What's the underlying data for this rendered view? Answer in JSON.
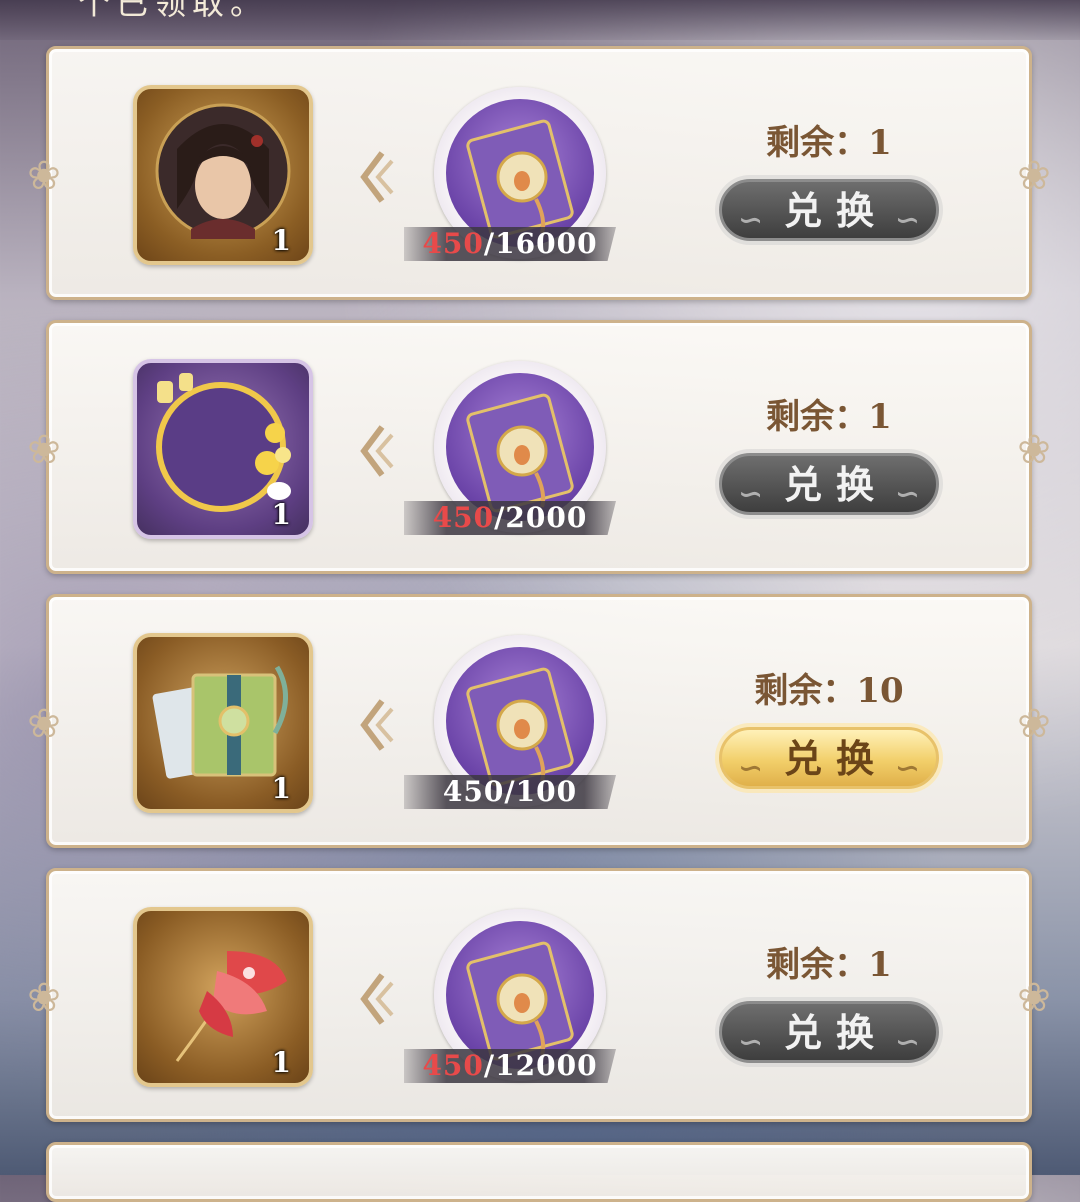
{
  "header": {
    "text_fragment": "个已领取。"
  },
  "items": [
    {
      "reward_type": "avatar",
      "reward_count": "1",
      "cost_have": "450",
      "cost_sep_total": "/16000",
      "cost_sufficient": false,
      "remaining_label": "剩余：1",
      "button_label": "兑换",
      "button_state": "disabled"
    },
    {
      "reward_type": "avatar-frame",
      "reward_count": "1",
      "cost_have": "450",
      "cost_sep_total": "/2000",
      "cost_sufficient": false,
      "remaining_label": "剩余：1",
      "button_label": "兑换",
      "button_state": "disabled"
    },
    {
      "reward_type": "green-book",
      "reward_count": "1",
      "cost_have": "450",
      "cost_sep_total": "/100",
      "cost_sufficient": true,
      "remaining_label": "剩余：10",
      "button_label": "兑换",
      "button_state": "active"
    },
    {
      "reward_type": "red-feather",
      "reward_count": "1",
      "cost_have": "450",
      "cost_sep_total": "/12000",
      "cost_sufficient": false,
      "remaining_label": "剩余：1",
      "button_label": "兑换",
      "button_state": "disabled"
    }
  ],
  "colors": {
    "insufficient": "#e84a4a",
    "card_border": "#cdb28b",
    "remain_text": "#7a5634",
    "gold_button": "#f2cf6a",
    "gray_button": "#4e4e4e"
  }
}
